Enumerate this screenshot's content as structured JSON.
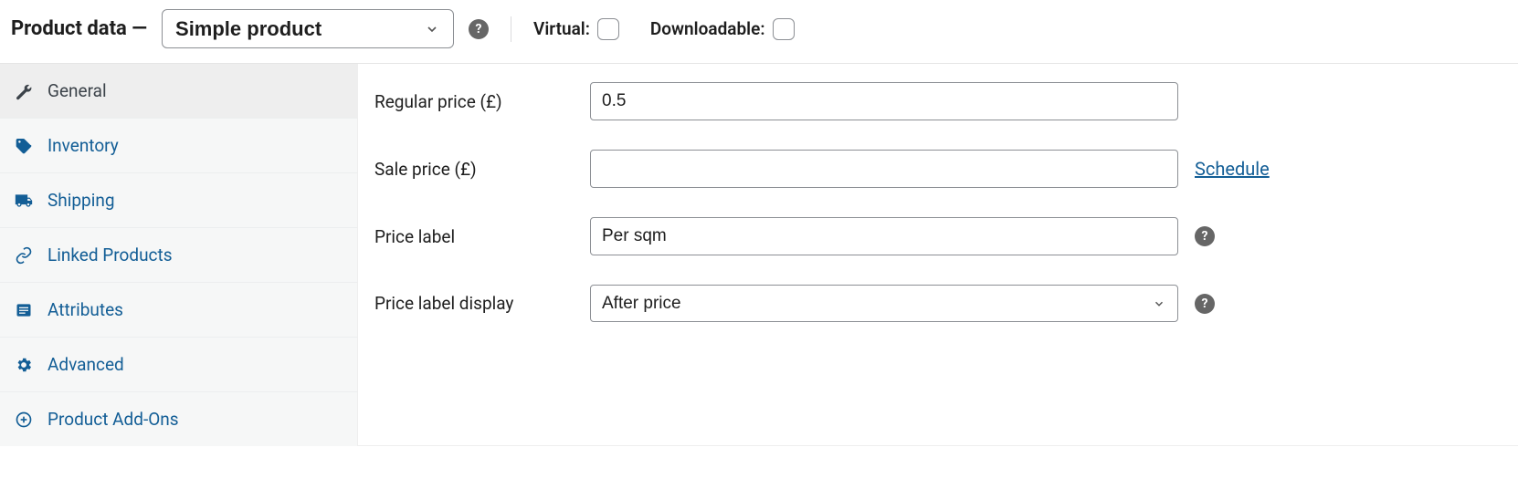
{
  "header": {
    "title": "Product data —",
    "product_type": "Simple product",
    "virtual_label": "Virtual:",
    "downloadable_label": "Downloadable:"
  },
  "sidebar": {
    "items": [
      {
        "label": "General"
      },
      {
        "label": "Inventory"
      },
      {
        "label": "Shipping"
      },
      {
        "label": "Linked Products"
      },
      {
        "label": "Attributes"
      },
      {
        "label": "Advanced"
      },
      {
        "label": "Product Add-Ons"
      }
    ]
  },
  "fields": {
    "regular_price": {
      "label": "Regular price (£)",
      "value": "0.5"
    },
    "sale_price": {
      "label": "Sale price (£)",
      "value": "",
      "schedule_link": "Schedule"
    },
    "price_label": {
      "label": "Price label",
      "value": "Per sqm"
    },
    "price_label_display": {
      "label": "Price label display",
      "value": "After price"
    }
  }
}
